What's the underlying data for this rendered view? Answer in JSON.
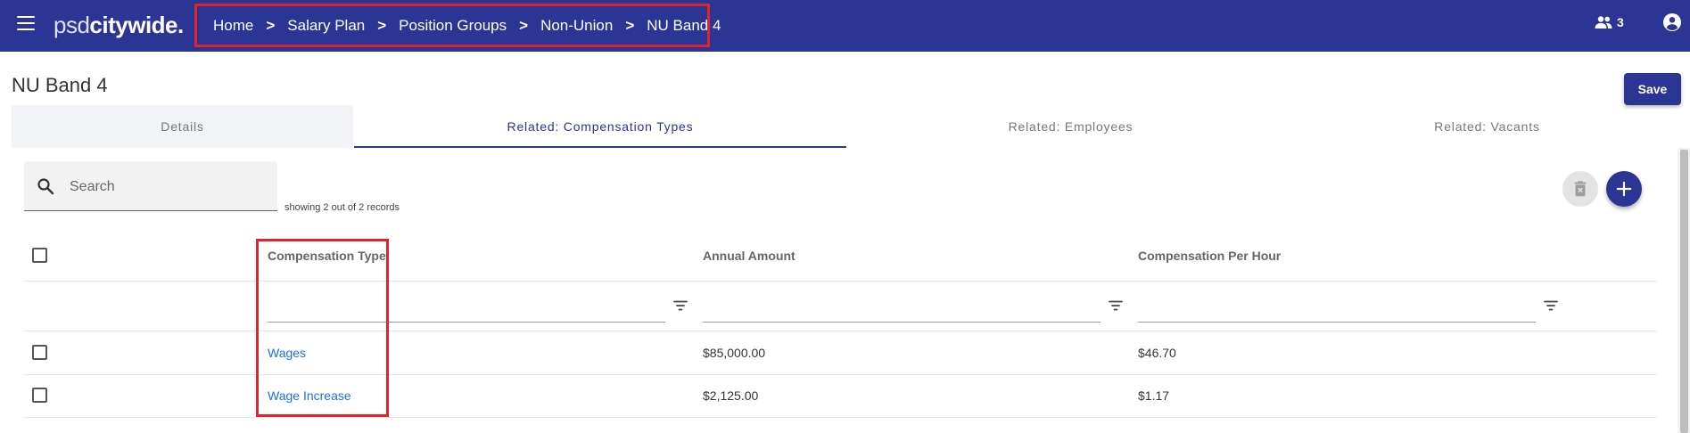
{
  "header": {
    "logo_psd": "psd",
    "logo_city": "citywide",
    "logo_dot": ".",
    "breadcrumb": [
      "Home",
      "Salary Plan",
      "Position Groups",
      "Non-Union",
      "NU Band 4"
    ],
    "separator": ">",
    "users_count": "3"
  },
  "page": {
    "title": "NU Band 4",
    "save_label": "Save"
  },
  "tabs": [
    {
      "label": "Details"
    },
    {
      "label": "Related: Compensation Types"
    },
    {
      "label": "Related: Employees"
    },
    {
      "label": "Related: Vacants"
    }
  ],
  "active_tab": 1,
  "search": {
    "placeholder": "Search",
    "records_text": "showing 2 out of 2 records"
  },
  "table": {
    "columns": [
      "Compensation Type",
      "Annual Amount",
      "Compensation Per Hour"
    ],
    "rows": [
      {
        "type": "Wages",
        "annual": "$85,000.00",
        "hourly": "$46.70"
      },
      {
        "type": "Wage Increase",
        "annual": "$2,125.00",
        "hourly": "$1.17"
      }
    ]
  },
  "colors": {
    "primary": "#2b3593",
    "link": "#1a73e8",
    "highlight": "#e0232d"
  }
}
